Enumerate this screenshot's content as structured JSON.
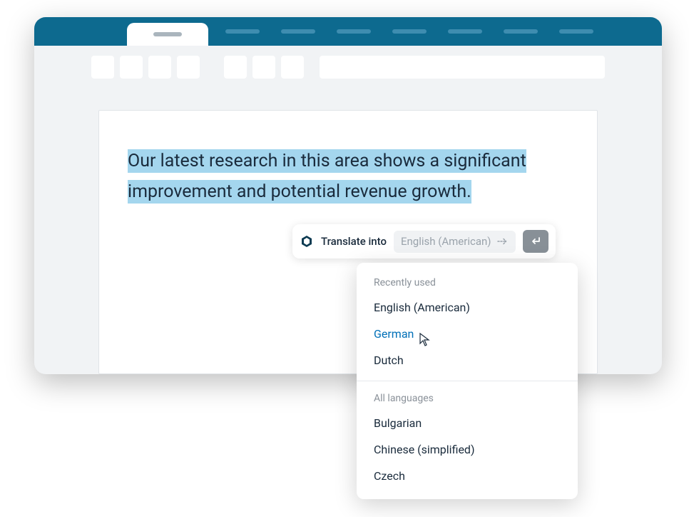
{
  "document": {
    "highlightedText": "Our latest research in this area shows a significant improvement and potential revenue growth."
  },
  "translatePopup": {
    "label": "Translate into",
    "placeholder": "English (American)"
  },
  "dropdown": {
    "recentLabel": "Recently used",
    "recent": [
      {
        "label": "English (American)",
        "selected": false
      },
      {
        "label": "German",
        "selected": true
      },
      {
        "label": "Dutch",
        "selected": false
      }
    ],
    "allLabel": "All languages",
    "all": [
      {
        "label": "Bulgarian"
      },
      {
        "label": "Chinese (simplified)"
      },
      {
        "label": "Czech"
      }
    ]
  }
}
